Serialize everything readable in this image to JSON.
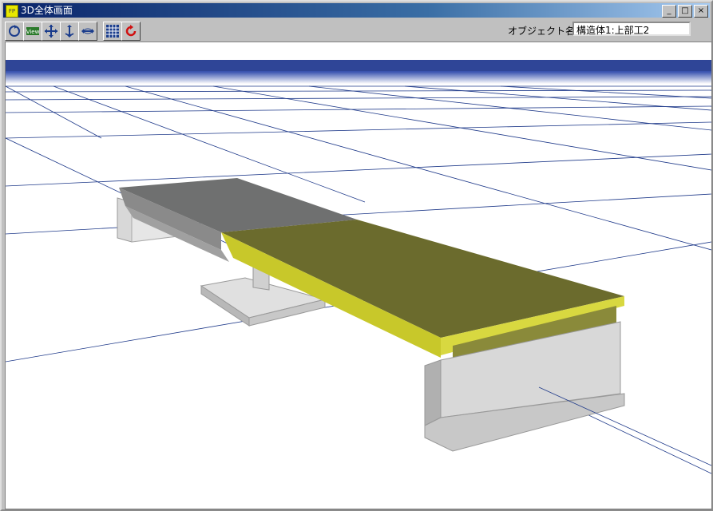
{
  "window": {
    "title": "3D全体画面",
    "minimize_glyph": "_",
    "maximize_glyph": "□",
    "close_glyph": "×"
  },
  "toolbar": {
    "buttons": [
      {
        "icon": "rotate-view-icon"
      },
      {
        "icon": "view-icon",
        "text": "View"
      },
      {
        "icon": "pan-icon"
      },
      {
        "icon": "zoom-icon"
      },
      {
        "icon": "rotate-horizontal-icon"
      },
      {
        "icon": "grid-toggle-icon"
      },
      {
        "icon": "reset-icon"
      }
    ],
    "object_label": "オブジェクト名",
    "object_value": "構造体1:上部工2"
  },
  "colors": {
    "sky_top": "#2b3f8c",
    "grid_line": "#1f3a8a",
    "deck_gray": "#6f7070",
    "deck_olive": "#6b6b2d",
    "deck_yellow": "#c8c82a",
    "abutment_light": "#d8d8d8",
    "abutment_shade": "#b0b0b0"
  }
}
